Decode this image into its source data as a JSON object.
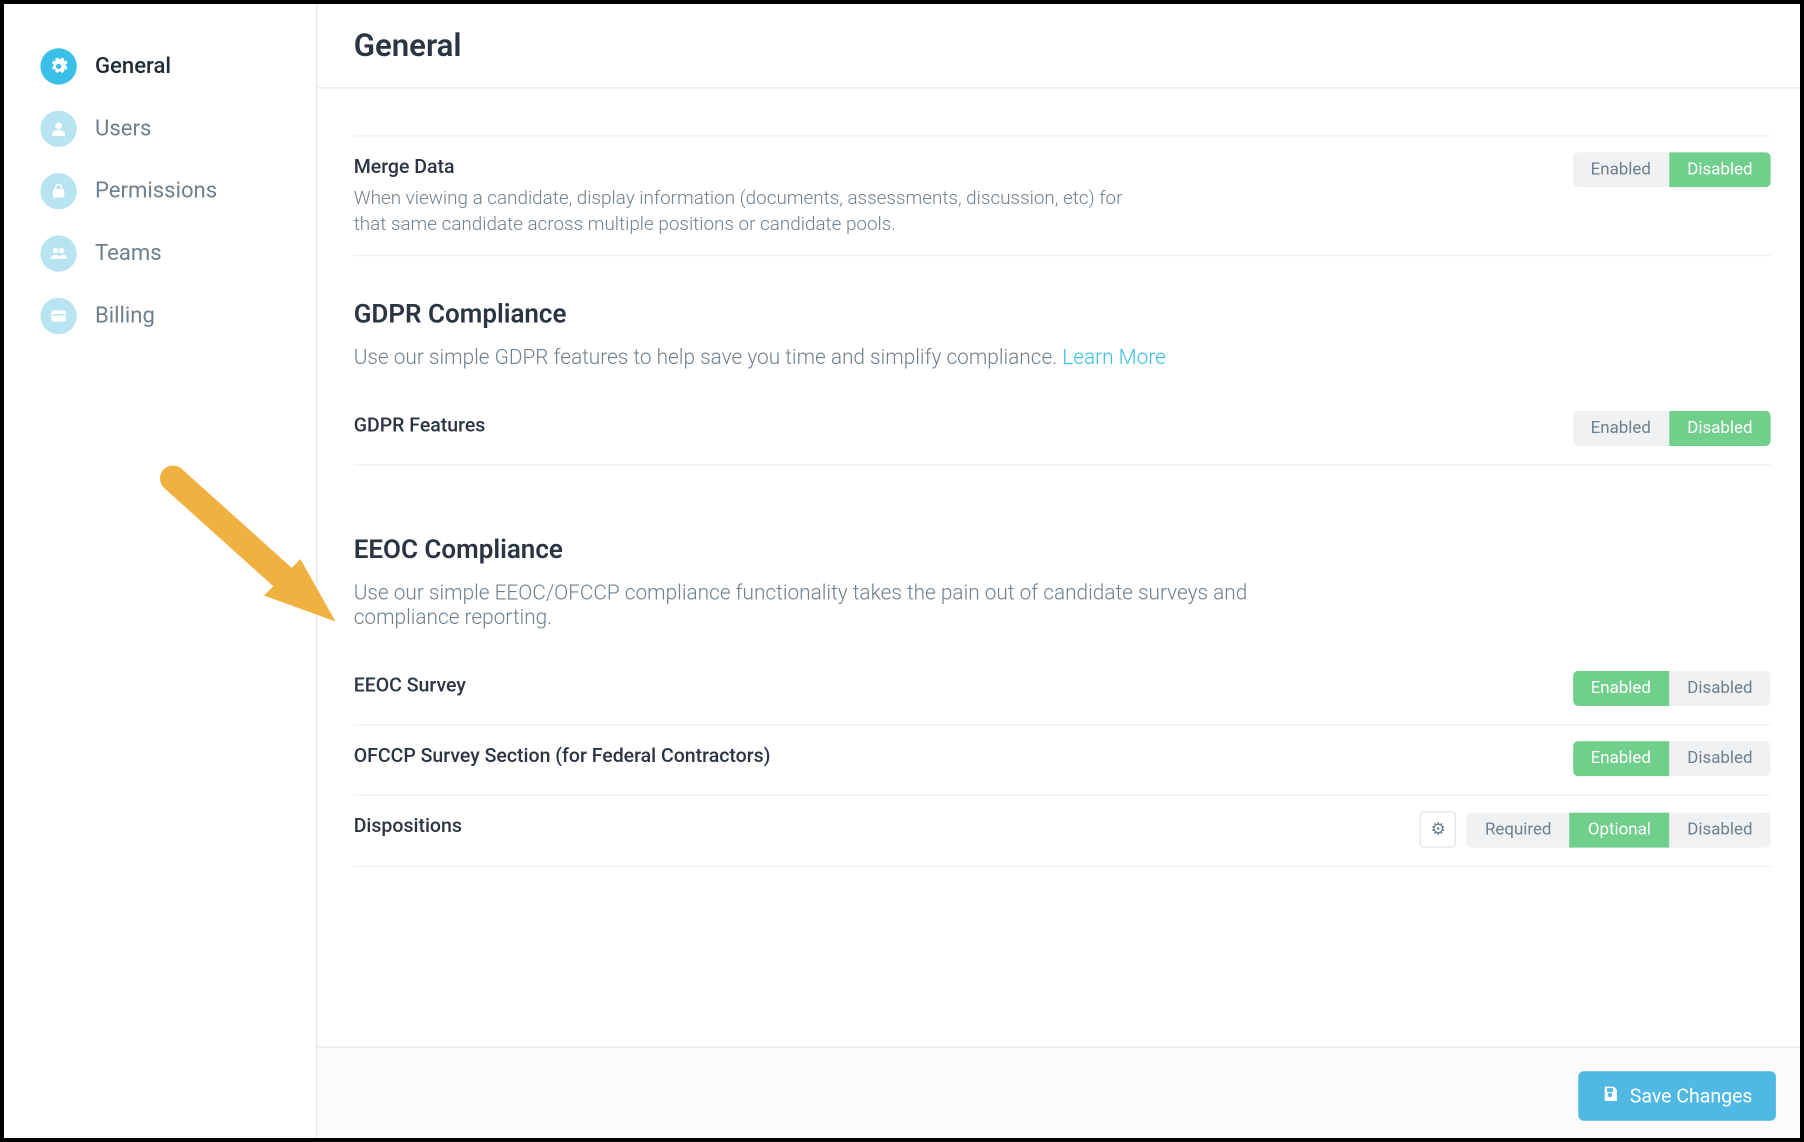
{
  "page_title": "General",
  "sidebar": {
    "items": [
      {
        "label": "General",
        "icon": "gear",
        "active": true
      },
      {
        "label": "Users",
        "icon": "user",
        "active": false
      },
      {
        "label": "Permissions",
        "icon": "lock",
        "active": false
      },
      {
        "label": "Teams",
        "icon": "people",
        "active": false
      },
      {
        "label": "Billing",
        "icon": "card",
        "active": false
      }
    ]
  },
  "sections": {
    "merge": {
      "title": "Merge Data",
      "desc": "When viewing a candidate, display information (documents, assessments, discussion, etc) for that same candidate across multiple positions or candidate pools.",
      "options": {
        "enabled": "Enabled",
        "disabled": "Disabled"
      },
      "value": "disabled"
    },
    "gdpr": {
      "heading": "GDPR Compliance",
      "intro": "Use our simple GDPR features to help save you time and simplify compliance. ",
      "learn_more": "Learn More",
      "feature_label": "GDPR Features",
      "options": {
        "enabled": "Enabled",
        "disabled": "Disabled"
      },
      "value": "disabled"
    },
    "eeoc": {
      "heading": "EEOC Compliance",
      "intro": "Use our simple EEOC/OFCCP compliance functionality takes the pain out of candidate surveys and compliance reporting.",
      "rows": {
        "survey": {
          "label": "EEOC Survey",
          "options": {
            "enabled": "Enabled",
            "disabled": "Disabled"
          },
          "value": "enabled"
        },
        "ofccp": {
          "label": "OFCCP Survey Section (for Federal Contractors)",
          "options": {
            "enabled": "Enabled",
            "disabled": "Disabled"
          },
          "value": "enabled"
        },
        "dispositions": {
          "label": "Dispositions",
          "options": {
            "required": "Required",
            "optional": "Optional",
            "disabled": "Disabled"
          },
          "value": "optional"
        }
      }
    }
  },
  "footer": {
    "save_label": "Save Changes"
  },
  "colors": {
    "accent": "#3ac0e8",
    "toggle_on": "#6fcf8b",
    "text_muted": "#6e7f8d"
  }
}
